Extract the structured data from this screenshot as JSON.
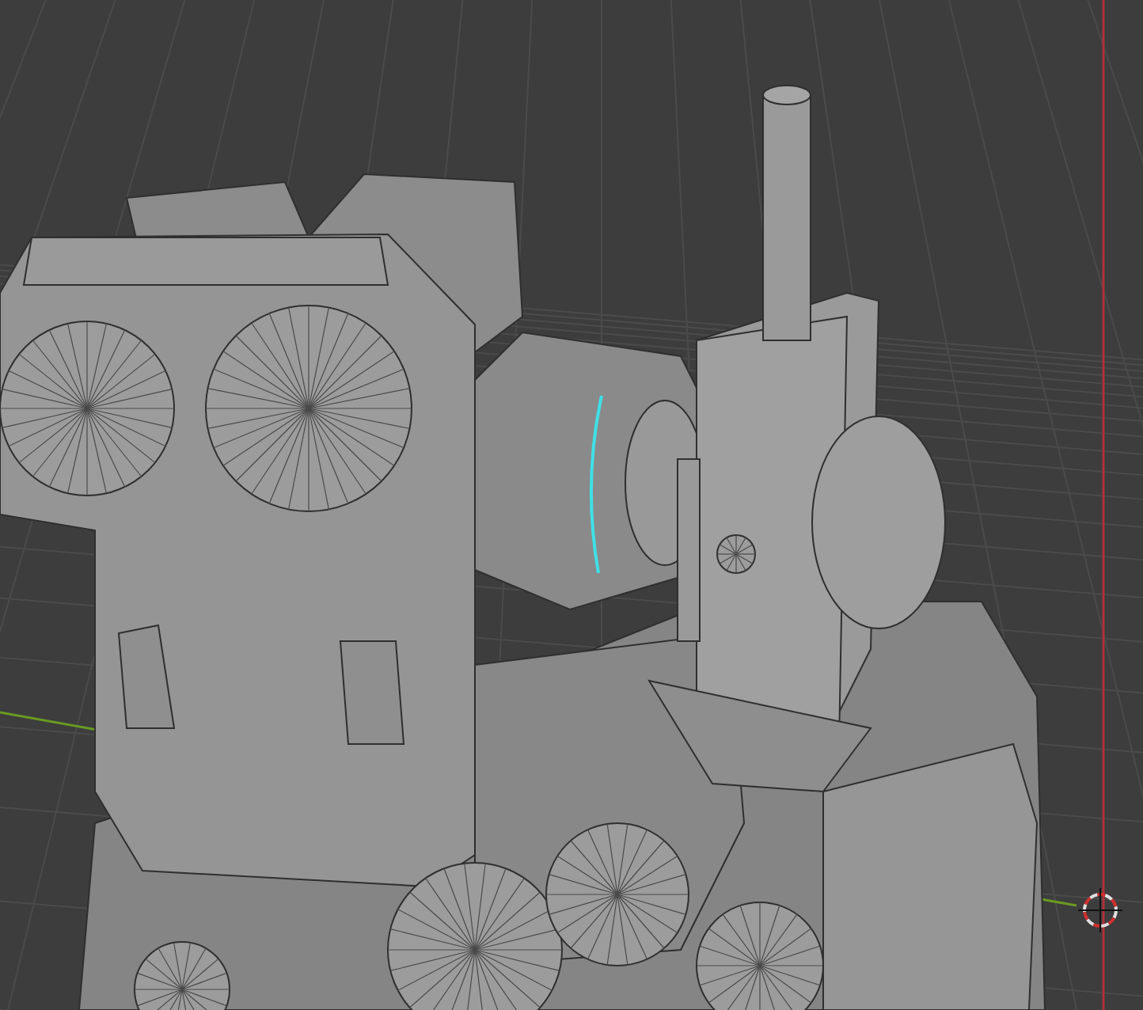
{
  "viewport": {
    "show_grid": true,
    "show_axes": true,
    "show_selection": true,
    "show_cursor": true
  }
}
